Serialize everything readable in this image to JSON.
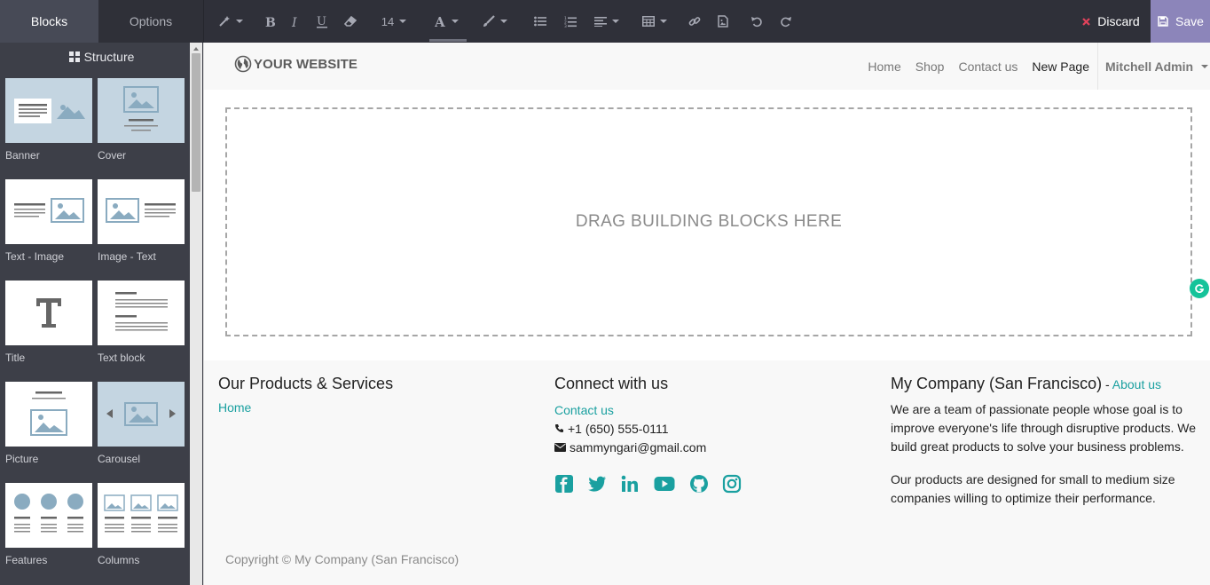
{
  "sidebar": {
    "tabs": {
      "blocks": "Blocks",
      "options": "Options"
    },
    "section_title": "Structure",
    "blocks": [
      {
        "label": "Banner"
      },
      {
        "label": "Cover"
      },
      {
        "label": "Text - Image"
      },
      {
        "label": "Image - Text"
      },
      {
        "label": "Title"
      },
      {
        "label": "Text block"
      },
      {
        "label": "Picture"
      },
      {
        "label": "Carousel"
      },
      {
        "label": "Features"
      },
      {
        "label": "Columns"
      }
    ]
  },
  "toolbar": {
    "font_size": "14",
    "discard_label": "Discard",
    "save_label": "Save"
  },
  "site": {
    "logo_text": "YOUR WEBSITE",
    "nav": [
      "Home",
      "Shop",
      "Contact us",
      "New Page"
    ],
    "user": "Mitchell Admin"
  },
  "dropzone": {
    "text": "DRAG BUILDING BLOCKS HERE"
  },
  "footer": {
    "col1": {
      "title": "Our Products & Services",
      "link": "Home"
    },
    "col2": {
      "title": "Connect with us",
      "link": "Contact us",
      "phone": "+1 (650) 555-0111",
      "email": "sammyngari@gmail.com"
    },
    "col3": {
      "title": "My Company (San Francisco)",
      "separator": " - ",
      "link": "About us",
      "p1": "We are a team of passionate people whose goal is to improve everyone's life through disruptive products. We build great products to solve your business problems.",
      "p2": "Our products are designed for small to medium size companies willing to optimize their performance."
    },
    "copyright": "Copyright © My Company (San Francisco)"
  },
  "colors": {
    "accent": "#1aa0a0",
    "save": "#8c85ba",
    "sidebar": "#3d3f48",
    "toolbar": "#2f3039",
    "discard_x": "#e0425b"
  }
}
